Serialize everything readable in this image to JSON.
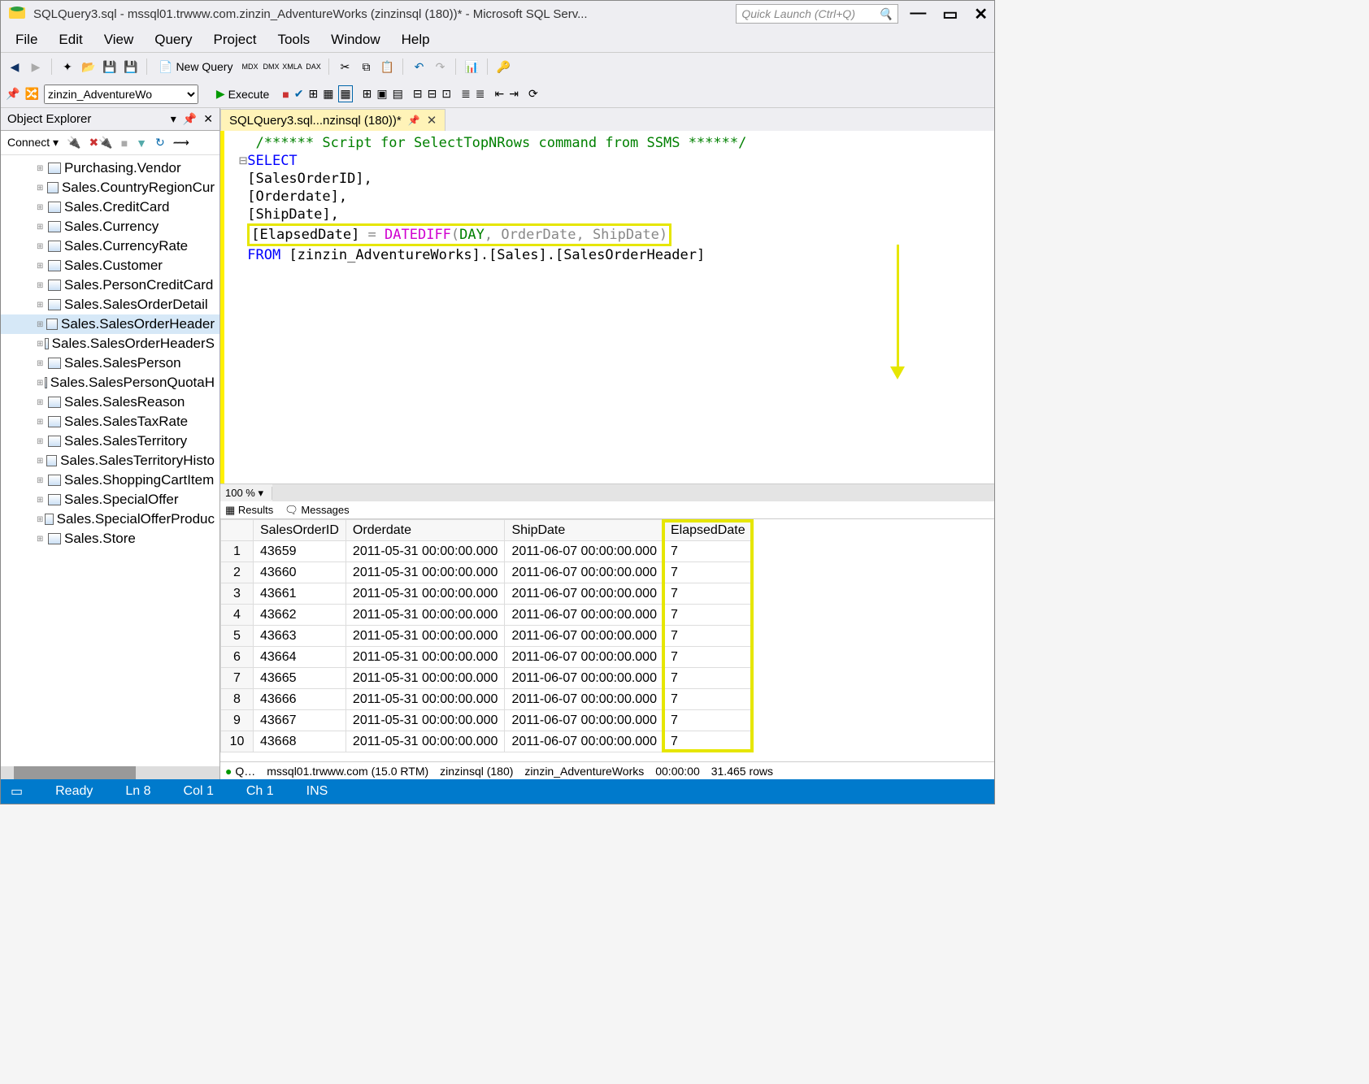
{
  "titlebar": {
    "title": "SQLQuery3.sql - mssql01.trwww.com.zinzin_AdventureWorks (zinzinsql (180))* - Microsoft SQL Serv...",
    "quicklaunch_placeholder": "Quick Launch (Ctrl+Q)"
  },
  "menubar": [
    "File",
    "Edit",
    "View",
    "Query",
    "Project",
    "Tools",
    "Window",
    "Help"
  ],
  "toolbar": {
    "new_query": "New Query"
  },
  "toolbar2": {
    "database": "zinzin_AdventureWo",
    "execute": "Execute"
  },
  "object_explorer": {
    "title": "Object Explorer",
    "connect": "Connect",
    "items": [
      "Purchasing.Vendor",
      "Sales.CountryRegionCur",
      "Sales.CreditCard",
      "Sales.Currency",
      "Sales.CurrencyRate",
      "Sales.Customer",
      "Sales.PersonCreditCard",
      "Sales.SalesOrderDetail",
      "Sales.SalesOrderHeader",
      "Sales.SalesOrderHeaderS",
      "Sales.SalesPerson",
      "Sales.SalesPersonQuotaH",
      "Sales.SalesReason",
      "Sales.SalesTaxRate",
      "Sales.SalesTerritory",
      "Sales.SalesTerritoryHisto",
      "Sales.ShoppingCartItem",
      "Sales.SpecialOffer",
      "Sales.SpecialOfferProduc",
      "Sales.Store"
    ],
    "selected_index": 8
  },
  "tab": {
    "label": "SQLQuery3.sql...nzinsql (180))*"
  },
  "code": {
    "comment": "/****** Script for SelectTopNRows command from SSMS  ******/",
    "select": "SELECT",
    "cols": [
      "[SalesOrderID],",
      "[Orderdate],",
      "[ShipDate],"
    ],
    "elapsed_col": "[ElapsedDate]",
    "eq": " = ",
    "datediff": "DATEDIFF",
    "op": "(",
    "day": "DAY",
    "args": ", OrderDate, ShipDate",
    "cp": ")",
    "from": "FROM",
    "from_rest": " [zinzin_AdventureWorks].[Sales].[SalesOrderHeader]"
  },
  "zoom": "100 %",
  "results_tabs": {
    "results": "Results",
    "messages": "Messages"
  },
  "results": {
    "headers": [
      "SalesOrderID",
      "Orderdate",
      "ShipDate",
      "ElapsedDate"
    ],
    "rows": [
      [
        "43659",
        "2011-05-31 00:00:00.000",
        "2011-06-07 00:00:00.000",
        "7"
      ],
      [
        "43660",
        "2011-05-31 00:00:00.000",
        "2011-06-07 00:00:00.000",
        "7"
      ],
      [
        "43661",
        "2011-05-31 00:00:00.000",
        "2011-06-07 00:00:00.000",
        "7"
      ],
      [
        "43662",
        "2011-05-31 00:00:00.000",
        "2011-06-07 00:00:00.000",
        "7"
      ],
      [
        "43663",
        "2011-05-31 00:00:00.000",
        "2011-06-07 00:00:00.000",
        "7"
      ],
      [
        "43664",
        "2011-05-31 00:00:00.000",
        "2011-06-07 00:00:00.000",
        "7"
      ],
      [
        "43665",
        "2011-05-31 00:00:00.000",
        "2011-06-07 00:00:00.000",
        "7"
      ],
      [
        "43666",
        "2011-05-31 00:00:00.000",
        "2011-06-07 00:00:00.000",
        "7"
      ],
      [
        "43667",
        "2011-05-31 00:00:00.000",
        "2011-06-07 00:00:00.000",
        "7"
      ],
      [
        "43668",
        "2011-05-31 00:00:00.000",
        "2011-06-07 00:00:00.000",
        "7"
      ]
    ]
  },
  "status_strip": {
    "ok": "Q…",
    "server": "mssql01.trwww.com (15.0 RTM)",
    "user": "zinzinsql (180)",
    "db": "zinzin_AdventureWorks",
    "time": "00:00:00",
    "rows": "31.465 rows"
  },
  "statusbar": {
    "ready": "Ready",
    "ln": "Ln 8",
    "col": "Col 1",
    "ch": "Ch 1",
    "ins": "INS"
  }
}
